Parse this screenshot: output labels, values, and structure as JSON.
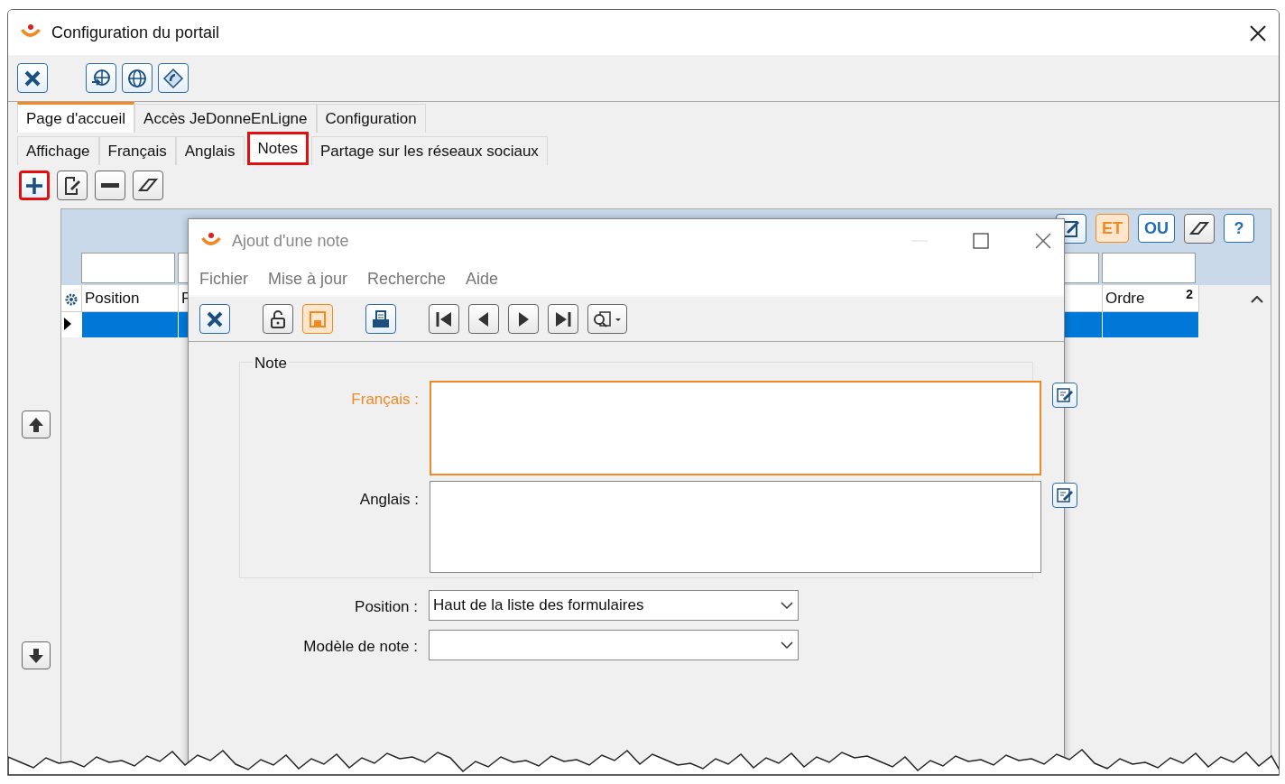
{
  "window": {
    "title": "Configuration du portail"
  },
  "toolbar": [
    {
      "kind": "close"
    },
    {
      "kind": "globe-arrow"
    },
    {
      "kind": "globe"
    },
    {
      "kind": "diamond"
    }
  ],
  "tabs": [
    {
      "label": "Page d'accueil",
      "selected": true
    },
    {
      "label": "Accès JeDonneEnLigne",
      "selected": false
    },
    {
      "label": "Configuration",
      "selected": false
    }
  ],
  "subtabs": [
    {
      "label": "Affichage",
      "selected": false,
      "highlighted": false
    },
    {
      "label": "Français",
      "selected": false,
      "highlighted": false
    },
    {
      "label": "Anglais",
      "selected": false,
      "highlighted": false
    },
    {
      "label": "Notes",
      "selected": true,
      "highlighted": true
    },
    {
      "label": "Partage sur les réseaux sociaux",
      "selected": false,
      "highlighted": false
    }
  ],
  "list_toolbar": [
    {
      "kind": "add",
      "highlighted": true
    },
    {
      "kind": "edit",
      "highlighted": false
    },
    {
      "kind": "remove",
      "highlighted": false
    },
    {
      "kind": "erase",
      "highlighted": false
    }
  ],
  "filter_buttons": [
    {
      "kind": "icon"
    },
    {
      "kind": "text",
      "label": "ET",
      "color": "#f08a24"
    },
    {
      "kind": "text",
      "label": "OU",
      "color": "#1f6fb2"
    },
    {
      "kind": "eraser"
    },
    {
      "kind": "text",
      "label": "?",
      "color": "#1f6fb2"
    }
  ],
  "grid": {
    "columns": [
      {
        "label": "Position"
      },
      {
        "label": "F"
      },
      {
        "label": "Ordre",
        "sort": "2"
      }
    ],
    "rows": [
      {
        "selected": true
      }
    ]
  },
  "dialog": {
    "title": "Ajout d'une note",
    "menu": [
      "Fichier",
      "Mise à jour",
      "Recherche",
      "Aide"
    ],
    "toolbar": [
      {
        "kind": "close"
      },
      {
        "kind": "unlock"
      },
      {
        "kind": "save"
      },
      {
        "kind": "print"
      },
      {
        "kind": "first"
      },
      {
        "kind": "prev"
      },
      {
        "kind": "next"
      },
      {
        "kind": "last"
      },
      {
        "kind": "search-menu"
      }
    ],
    "group": {
      "title": "Note",
      "fields": [
        {
          "label": "Français :",
          "focused": true
        },
        {
          "label": "Anglais :",
          "focused": false
        }
      ]
    },
    "selects": [
      {
        "label": "Position :",
        "value": "Haut de la liste des formulaires"
      },
      {
        "label": "Modèle de note :"
      }
    ]
  }
}
